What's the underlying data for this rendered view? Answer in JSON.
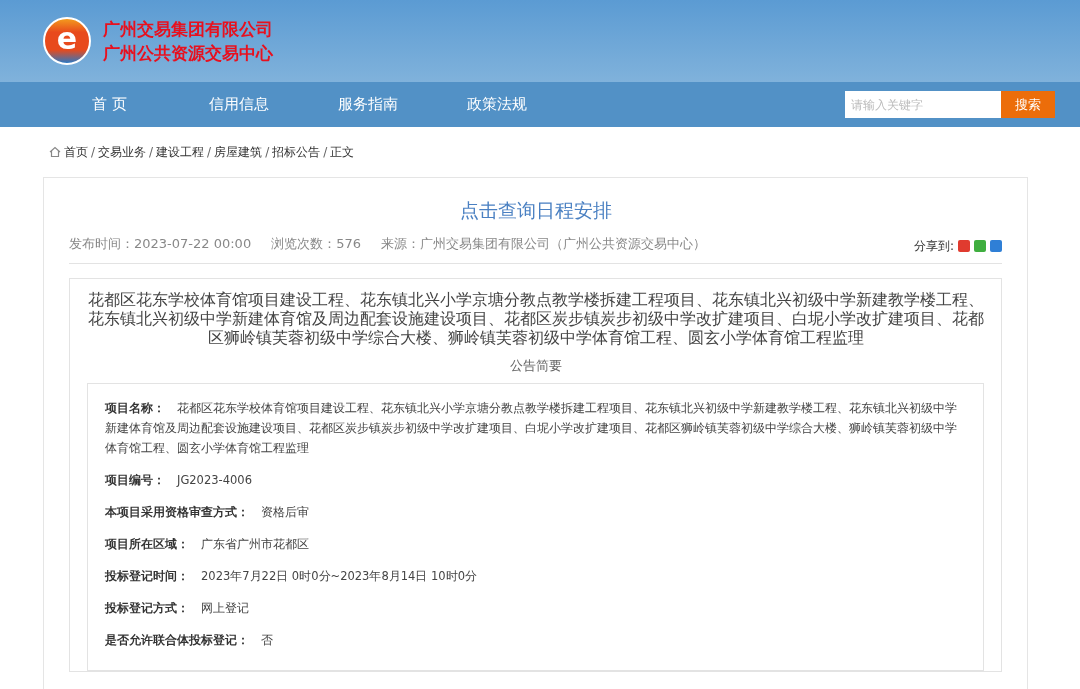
{
  "header": {
    "logo_letter": "e",
    "org_lines": [
      "广州交易集团有限公司",
      "广州公共资源交易中心"
    ]
  },
  "nav": {
    "items": [
      {
        "label": "首 页"
      },
      {
        "label": "信用信息"
      },
      {
        "label": "服务指南"
      },
      {
        "label": "政策法规"
      }
    ],
    "search": {
      "placeholder": "请输入关键字",
      "button": "搜索"
    }
  },
  "breadcrumb": {
    "separator": "/",
    "items": [
      "首页",
      "交易业务",
      "建设工程",
      "房屋建筑",
      "招标公告",
      "正文"
    ]
  },
  "article": {
    "title": "点击查询日程安排",
    "meta": [
      {
        "label": "发布时间：",
        "value": "2023-07-22 00:00"
      },
      {
        "label": "浏览次数：",
        "value": "576"
      },
      {
        "label": "来源：",
        "value": "广州交易集团有限公司（广州公共资源交易中心）"
      }
    ],
    "share_label": "分享到:",
    "share_icons": [
      {
        "color": "#e03b2f"
      },
      {
        "color": "#3fae3f"
      },
      {
        "color": "#2f7fd6"
      }
    ],
    "heading": "花都区花东学校体育馆项目建设工程、花东镇北兴小学京塘分教点教学楼拆建工程项目、花东镇北兴初级中学新建教学楼工程、花东镇北兴初级中学新建体育馆及周边配套设施建设项目、花都区炭步镇炭步初级中学改扩建项目、白坭小学改扩建项目、花都区狮岭镇芙蓉初级中学综合大楼、狮岭镇芙蓉初级中学体育馆工程、圆玄小学体育馆工程监理",
    "summary_label": "公告简要",
    "fields": [
      {
        "label": "项目名称：",
        "value": "花都区花东学校体育馆项目建设工程、花东镇北兴小学京塘分教点教学楼拆建工程项目、花东镇北兴初级中学新建教学楼工程、花东镇北兴初级中学新建体育馆及周边配套设施建设项目、花都区炭步镇炭步初级中学改扩建项目、白坭小学改扩建项目、花都区狮岭镇芙蓉初级中学综合大楼、狮岭镇芙蓉初级中学体育馆工程、圆玄小学体育馆工程监理"
      },
      {
        "label": "项目编号：",
        "value": "JG2023-4006"
      },
      {
        "label": "本项目采用资格审查方式：",
        "value": "资格后审"
      },
      {
        "label": "项目所在区域：",
        "value": "广东省广州市花都区"
      },
      {
        "label": "投标登记时间：",
        "value": "2023年7月22日 0时0分~2023年8月14日 10时0分"
      },
      {
        "label": "投标登记方式：",
        "value": "网上登记"
      },
      {
        "label": "是否允许联合体投标登记：",
        "value": "否"
      }
    ]
  }
}
